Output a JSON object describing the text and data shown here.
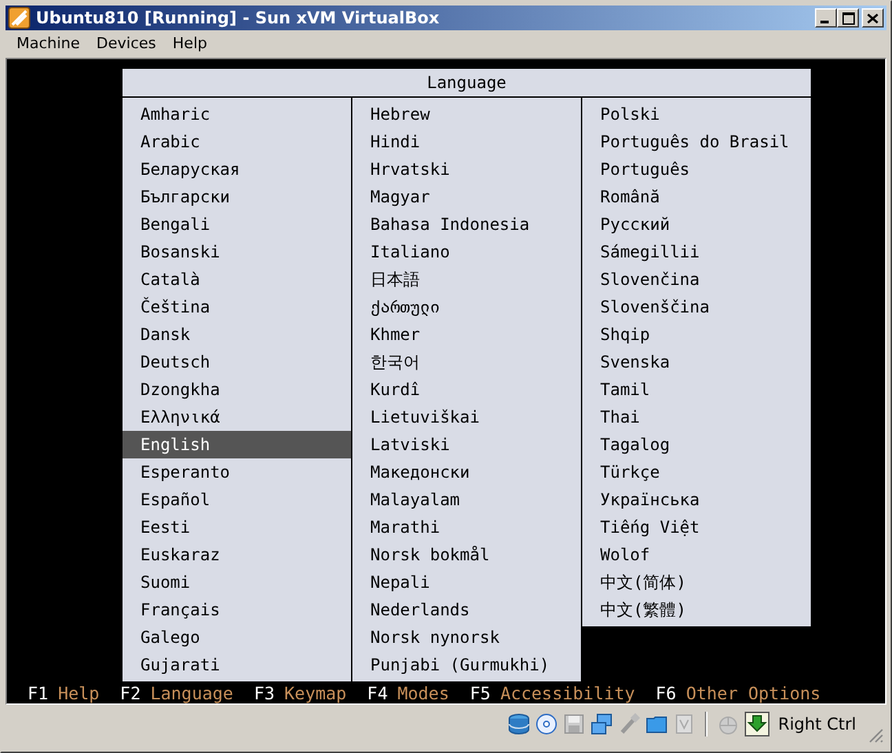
{
  "window": {
    "title": "Ubuntu810 [Running] - Sun xVM VirtualBox"
  },
  "menu": [
    "Machine",
    "Devices",
    "Help"
  ],
  "dialog": {
    "title": "Language",
    "columns": [
      [
        {
          "label": "Amharic",
          "selected": false
        },
        {
          "label": "Arabic",
          "selected": false
        },
        {
          "label": "Беларуская",
          "selected": false
        },
        {
          "label": "Български",
          "selected": false
        },
        {
          "label": "Bengali",
          "selected": false
        },
        {
          "label": "Bosanski",
          "selected": false
        },
        {
          "label": "Català",
          "selected": false
        },
        {
          "label": "Čeština",
          "selected": false
        },
        {
          "label": "Dansk",
          "selected": false
        },
        {
          "label": "Deutsch",
          "selected": false
        },
        {
          "label": "Dzongkha",
          "selected": false
        },
        {
          "label": "Ελληνικά",
          "selected": false
        },
        {
          "label": "English",
          "selected": true
        },
        {
          "label": "Esperanto",
          "selected": false
        },
        {
          "label": "Español",
          "selected": false
        },
        {
          "label": "Eesti",
          "selected": false
        },
        {
          "label": "Euskaraz",
          "selected": false
        },
        {
          "label": "Suomi",
          "selected": false
        },
        {
          "label": "Français",
          "selected": false
        },
        {
          "label": "Galego",
          "selected": false
        },
        {
          "label": "Gujarati",
          "selected": false
        }
      ],
      [
        {
          "label": "Hebrew",
          "selected": false
        },
        {
          "label": "Hindi",
          "selected": false
        },
        {
          "label": "Hrvatski",
          "selected": false
        },
        {
          "label": "Magyar",
          "selected": false
        },
        {
          "label": "Bahasa Indonesia",
          "selected": false
        },
        {
          "label": "Italiano",
          "selected": false
        },
        {
          "label": "日本語",
          "selected": false
        },
        {
          "label": "ქართული",
          "selected": false
        },
        {
          "label": "Khmer",
          "selected": false
        },
        {
          "label": "한국어",
          "selected": false
        },
        {
          "label": "Kurdî",
          "selected": false
        },
        {
          "label": "Lietuviškai",
          "selected": false
        },
        {
          "label": "Latviski",
          "selected": false
        },
        {
          "label": "Македонски",
          "selected": false
        },
        {
          "label": "Malayalam",
          "selected": false
        },
        {
          "label": "Marathi",
          "selected": false
        },
        {
          "label": "Norsk bokmål",
          "selected": false
        },
        {
          "label": "Nepali",
          "selected": false
        },
        {
          "label": "Nederlands",
          "selected": false
        },
        {
          "label": "Norsk nynorsk",
          "selected": false
        },
        {
          "label": "Punjabi (Gurmukhi)",
          "selected": false
        }
      ],
      [
        {
          "label": "Polski",
          "selected": false
        },
        {
          "label": "Português do Brasil",
          "selected": false
        },
        {
          "label": "Português",
          "selected": false
        },
        {
          "label": "Română",
          "selected": false
        },
        {
          "label": "Русский",
          "selected": false
        },
        {
          "label": "Sámegillii",
          "selected": false
        },
        {
          "label": "Slovenčina",
          "selected": false
        },
        {
          "label": "Slovenščina",
          "selected": false
        },
        {
          "label": "Shqip",
          "selected": false
        },
        {
          "label": "Svenska",
          "selected": false
        },
        {
          "label": "Tamil",
          "selected": false
        },
        {
          "label": "Thai",
          "selected": false
        },
        {
          "label": "Tagalog",
          "selected": false
        },
        {
          "label": "Türkçe",
          "selected": false
        },
        {
          "label": "Українська",
          "selected": false
        },
        {
          "label": "Tiếng Việt",
          "selected": false
        },
        {
          "label": "Wolof",
          "selected": false
        },
        {
          "label": "中文(简体)",
          "selected": false
        },
        {
          "label": "中文(繁體)",
          "selected": false
        }
      ]
    ]
  },
  "function_keys": [
    {
      "key": "F1",
      "label": "Help"
    },
    {
      "key": "F2",
      "label": "Language"
    },
    {
      "key": "F3",
      "label": "Keymap"
    },
    {
      "key": "F4",
      "label": "Modes"
    },
    {
      "key": "F5",
      "label": "Accessibility"
    },
    {
      "key": "F6",
      "label": "Other Options"
    }
  ],
  "status_bar": {
    "host_key": "Right Ctrl"
  }
}
